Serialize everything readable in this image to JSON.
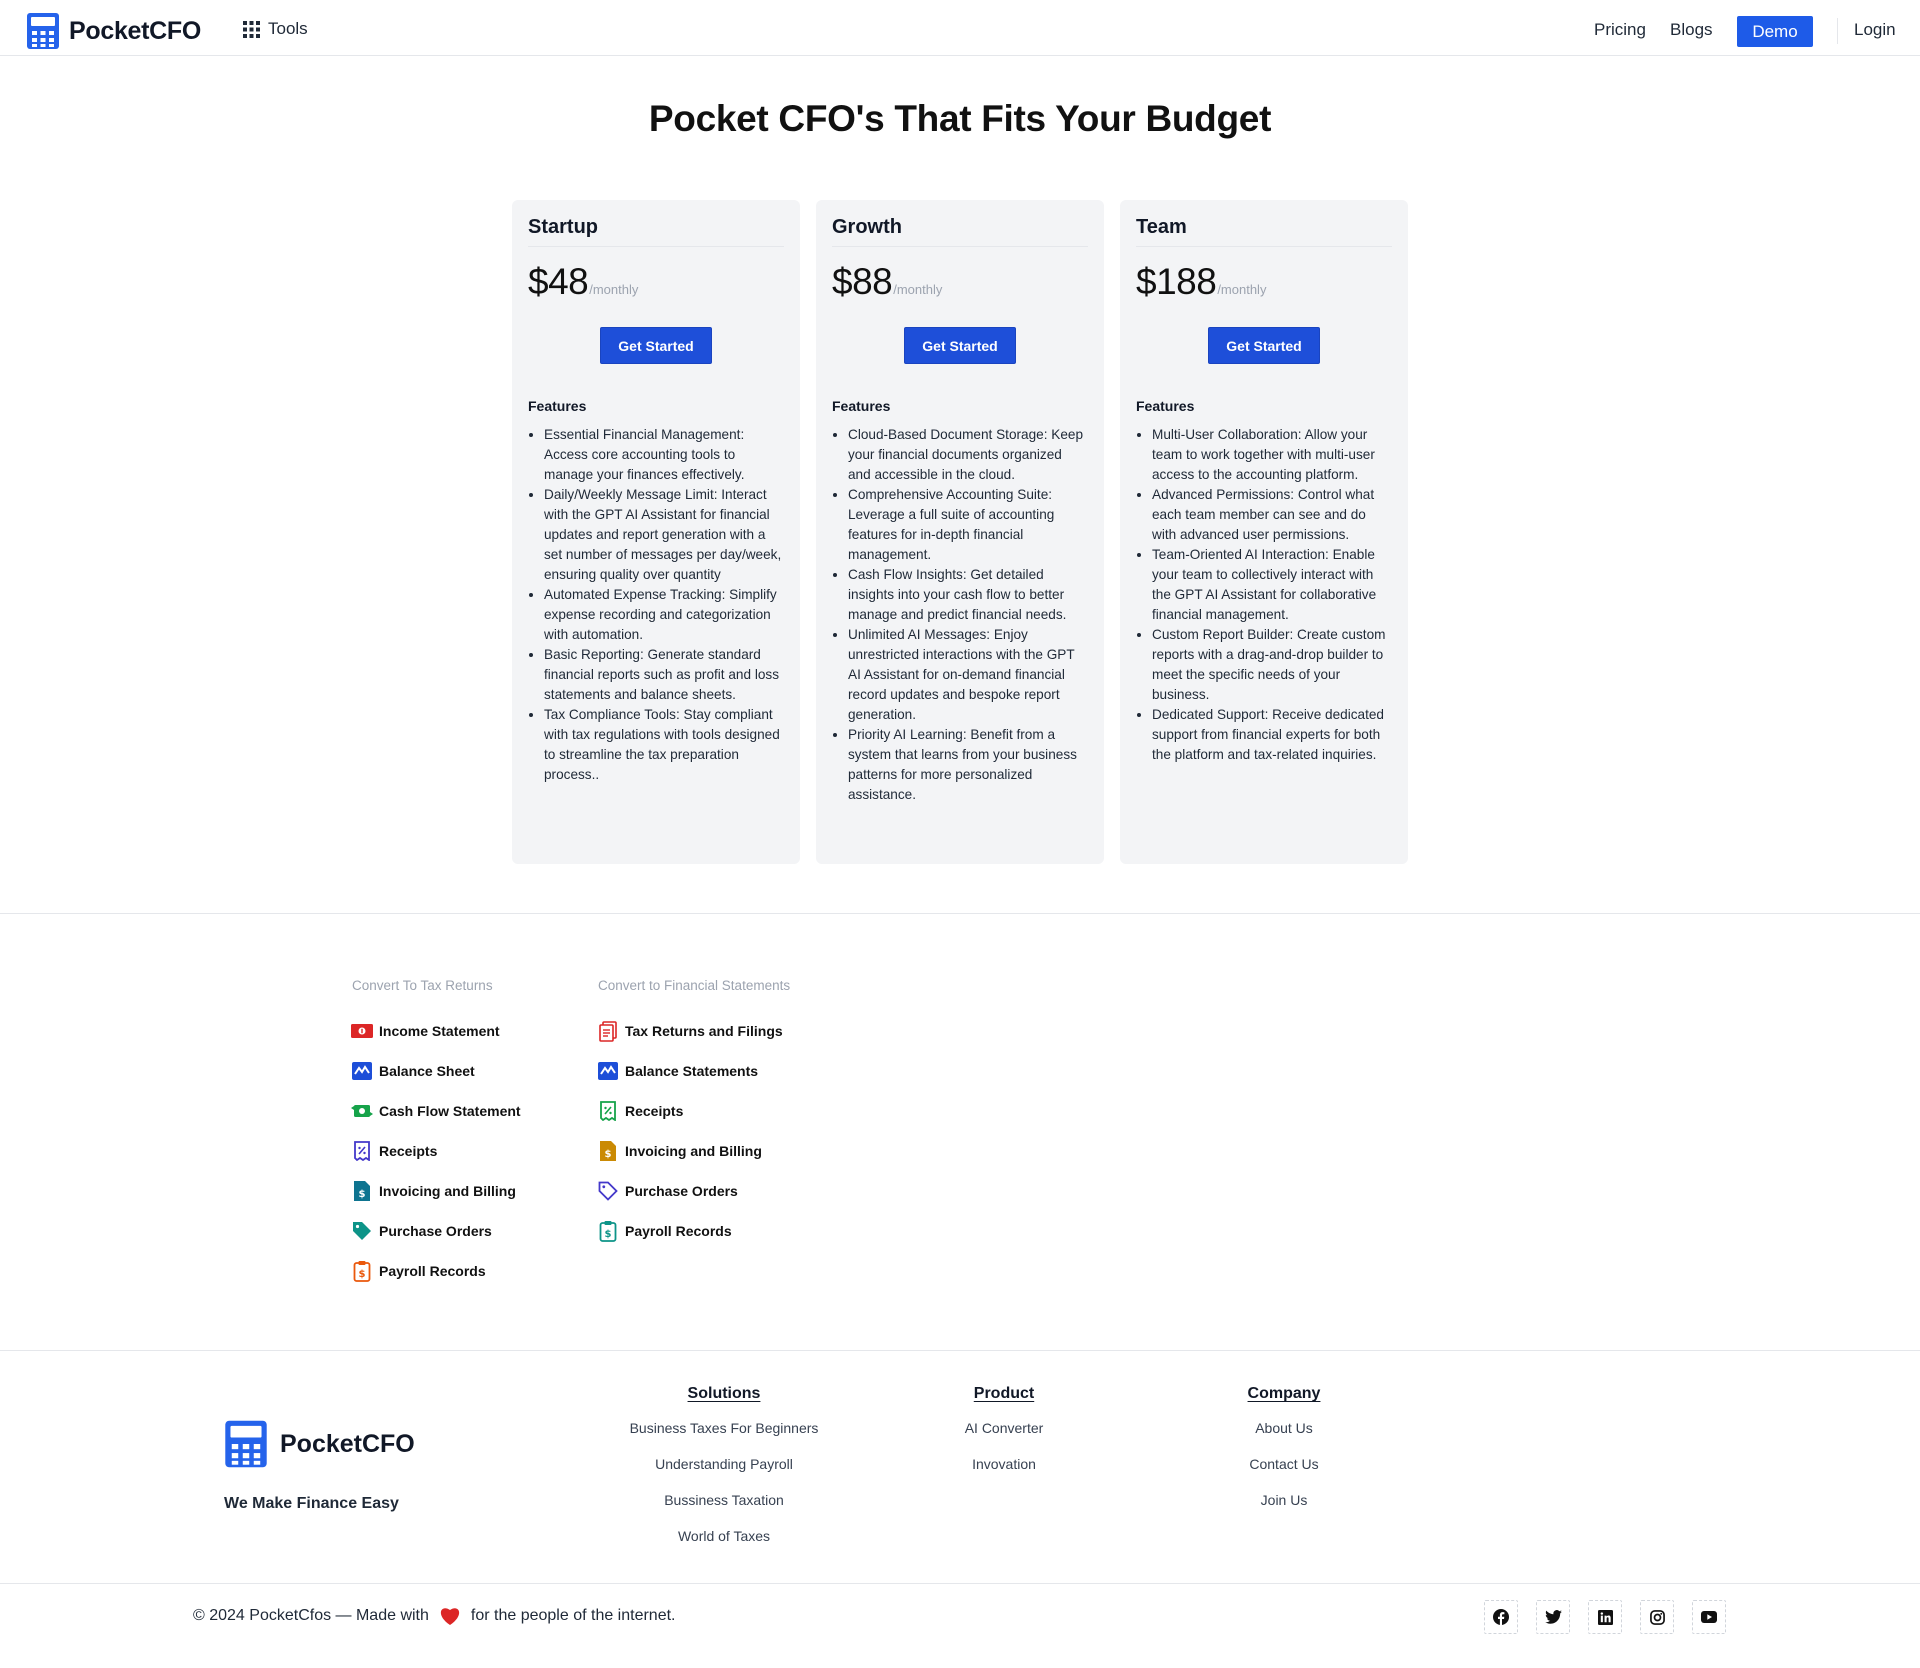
{
  "header": {
    "brand": "PocketCFO",
    "tools_label": "Tools",
    "nav": {
      "pricing": "Pricing",
      "blogs": "Blogs",
      "demo": "Demo",
      "login": "Login"
    }
  },
  "hero": {
    "title": "Pocket CFO's That Fits Your Budget"
  },
  "plans": [
    {
      "name": "Startup",
      "price": "$48",
      "period": "/monthly",
      "cta": "Get Started",
      "features_title": "Features",
      "features": [
        "Essential Financial Management: Access core accounting tools to manage your finances effectively.",
        "Daily/Weekly Message Limit: Interact with the GPT AI Assistant for financial updates and report generation with a set number of messages per day/week, ensuring quality over quantity",
        "Automated Expense Tracking: Simplify expense recording and categorization with automation.",
        "Basic Reporting: Generate standard financial reports such as profit and loss statements and balance sheets.",
        "Tax Compliance Tools: Stay compliant with tax regulations with tools designed to streamline the tax preparation process.."
      ]
    },
    {
      "name": "Growth",
      "price": "$88",
      "period": "/monthly",
      "cta": "Get Started",
      "features_title": "Features",
      "features": [
        "Cloud-Based Document Storage: Keep your financial documents organized and accessible in the cloud.",
        "Comprehensive Accounting Suite: Leverage a full suite of accounting features for in-depth financial management.",
        "Cash Flow Insights: Get detailed insights into your cash flow to better manage and predict financial needs.",
        "Unlimited AI Messages: Enjoy unrestricted interactions with the GPT AI Assistant for on-demand financial record updates and bespoke report generation.",
        "Priority AI Learning: Benefit from a system that learns from your business patterns for more personalized assistance."
      ]
    },
    {
      "name": "Team",
      "price": "$188",
      "period": "/monthly",
      "cta": "Get Started",
      "features_title": "Features",
      "features": [
        "Multi-User Collaboration: Allow your team to work together with multi-user access to the accounting platform.",
        "Advanced Permissions: Control what each team member can see and do with advanced user permissions.",
        "Team-Oriented AI Interaction: Enable your team to collectively interact with the GPT AI Assistant for collaborative financial management.",
        "Custom Report Builder: Create custom reports with a drag-and-drop builder to meet the specific needs of your business.",
        "Dedicated Support: Receive dedicated support from financial experts for both the platform and tax-related inquiries."
      ]
    }
  ],
  "tools": {
    "tax_returns": {
      "heading": "Convert To Tax Returns",
      "items": [
        {
          "label": "Income Statement",
          "icon": "cash-icon",
          "color": "#dc2626"
        },
        {
          "label": "Balance Sheet",
          "icon": "chart-wave-icon",
          "color": "#1d4ed8"
        },
        {
          "label": "Cash Flow Statement",
          "icon": "money-flow-icon",
          "color": "#16a34a"
        },
        {
          "label": "Receipts",
          "icon": "receipt-icon",
          "color": "#4338ca"
        },
        {
          "label": "Invoicing and Billing",
          "icon": "invoice-icon",
          "color": "#0e7490"
        },
        {
          "label": "Purchase Orders",
          "icon": "tag-icon",
          "color": "#0d9488"
        },
        {
          "label": "Payroll Records",
          "icon": "clipboard-dollar-icon",
          "color": "#ea580c"
        }
      ]
    },
    "financial_statements": {
      "heading": "Convert to Financial Statements",
      "items": [
        {
          "label": "Tax Returns and Filings",
          "icon": "documents-icon",
          "color": "#dc2626"
        },
        {
          "label": "Balance Statements",
          "icon": "chart-wave-icon",
          "color": "#1d4ed8"
        },
        {
          "label": "Receipts",
          "icon": "receipt-icon",
          "color": "#16a34a"
        },
        {
          "label": "Invoicing and Billing",
          "icon": "invoice-icon",
          "color": "#ca8a04"
        },
        {
          "label": "Purchase Orders",
          "icon": "tag-icon",
          "color": "#4338ca"
        },
        {
          "label": "Payroll Records",
          "icon": "clipboard-dollar-icon",
          "color": "#0d9488"
        }
      ]
    }
  },
  "footer": {
    "brand": "PocketCFO",
    "tagline": "We Make Finance Easy",
    "columns": [
      {
        "heading": "Solutions",
        "links": [
          "Business Taxes For Beginners",
          "Understanding Payroll",
          "Bussiness Taxation",
          "World of Taxes"
        ]
      },
      {
        "heading": "Product",
        "links": [
          "AI Converter",
          "Invovation"
        ]
      },
      {
        "heading": "Company",
        "links": [
          "About Us",
          "Contact Us",
          "Join Us"
        ]
      }
    ],
    "copyright_prefix": "© 2024 PocketCfos — Made with",
    "copyright_suffix": "for the people of the internet.",
    "socials": [
      "facebook-icon",
      "twitter-icon",
      "linkedin-icon",
      "instagram-icon",
      "youtube-icon"
    ]
  },
  "colors": {
    "primary": "#1e5be8",
    "cta": "#1e4fd9",
    "card_bg": "#f3f4f6",
    "heart": "#dc2626"
  }
}
